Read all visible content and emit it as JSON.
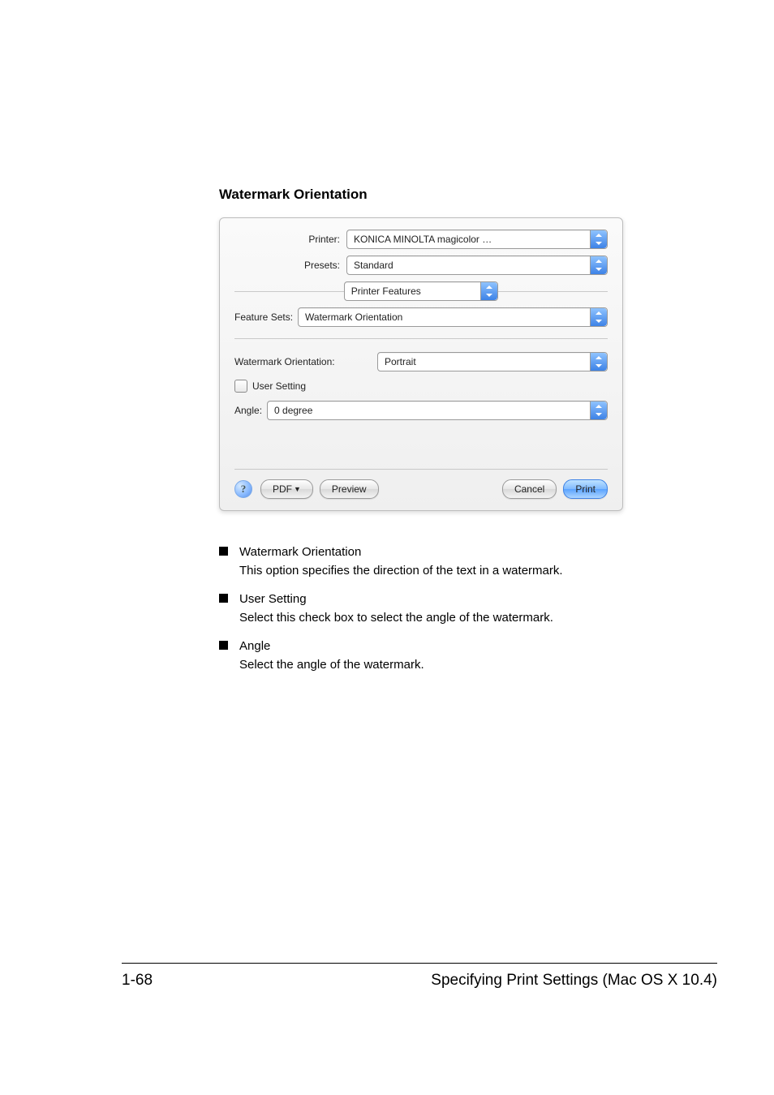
{
  "section_title": "Watermark Orientation",
  "dialog": {
    "printer_label": "Printer:",
    "printer_value": "KONICA MINOLTA magicolor …",
    "presets_label": "Presets:",
    "presets_value": "Standard",
    "pane_value": "Printer Features",
    "feature_sets_label": "Feature Sets:",
    "feature_sets_value": "Watermark Orientation",
    "wm_orient_label": "Watermark Orientation:",
    "wm_orient_value": "Portrait",
    "user_setting_label": "User Setting",
    "angle_label": "Angle:",
    "angle_value": "0 degree",
    "help_glyph": "?",
    "pdf_label": "PDF",
    "preview_label": "Preview",
    "cancel_label": "Cancel",
    "print_label": "Print"
  },
  "bullets": [
    {
      "head": "Watermark Orientation",
      "body": "This option specifies the direction of the text in a watermark."
    },
    {
      "head": "User Setting",
      "body": "Select this check box to select the angle of the watermark."
    },
    {
      "head": "Angle",
      "body": "Select the angle of the watermark."
    }
  ],
  "footer": {
    "page_num": "1-68",
    "title": "Specifying Print Settings (Mac OS X 10.4)"
  }
}
